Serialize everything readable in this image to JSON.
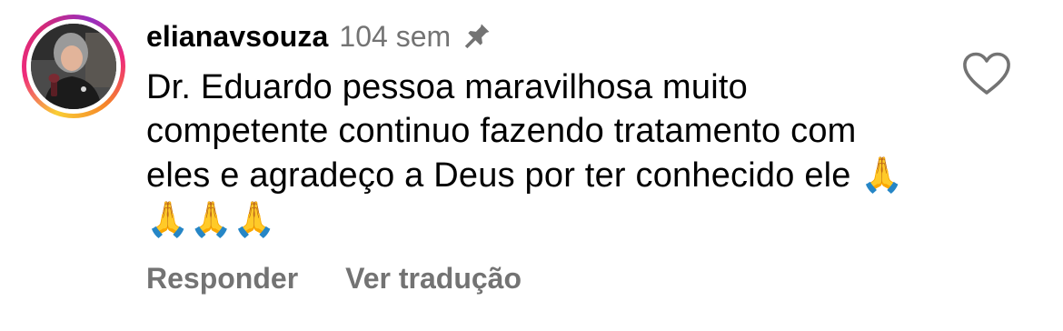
{
  "comment": {
    "username": "elianavsouza",
    "timestamp": "104 sem",
    "pinned_icon": "pin-icon",
    "text": "Dr. Eduardo pessoa maravilhosa muito competente continuo fazendo tratamento com eles e agradeço a Deus por ter conhecido ele ",
    "emojis": "🙏🙏🙏🙏",
    "like_icon": "heart-outline-icon"
  },
  "actions": {
    "reply_label": "Responder",
    "translate_label": "Ver tradução"
  },
  "colors": {
    "text_primary": "#000000",
    "text_secondary": "#737373",
    "story_ring_start": "#f9ce34",
    "story_ring_mid": "#ee2a7b",
    "story_ring_end": "#962fbf"
  }
}
